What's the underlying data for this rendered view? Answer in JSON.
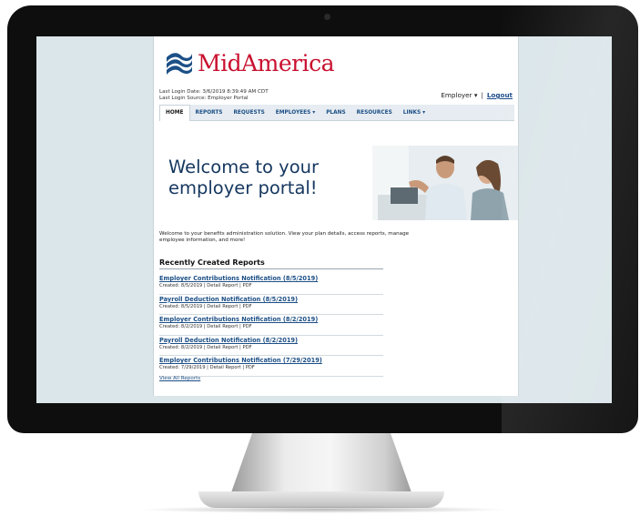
{
  "brand": {
    "name": "MidAmerica",
    "color": "#c8102e",
    "mark_color": "#1c4f86"
  },
  "login": {
    "date": "Last Login Date: 3/6/2019 8:39:49 AM CDT",
    "source": "Last Login Source: Employer Portal"
  },
  "user_menu": {
    "role": "Employer",
    "separator": "|",
    "logout": "Logout"
  },
  "nav": {
    "items": [
      {
        "label": "HOME",
        "active": true
      },
      {
        "label": "REPORTS"
      },
      {
        "label": "REQUESTS"
      },
      {
        "label": "EMPLOYEES ▾"
      },
      {
        "label": "PLANS"
      },
      {
        "label": "RESOURCES"
      },
      {
        "label": "LINKS ▾"
      }
    ]
  },
  "hero": {
    "headline_1": "Welcome to your",
    "headline_2": "employer portal!"
  },
  "intro": "Welcome to your benefits administration solution. View your plan details, access reports, manage employee information, and more!",
  "reports": {
    "title": "Recently Created Reports",
    "items": [
      {
        "title": "Employer Contributions Notification (8/5/2019)",
        "meta": "Created: 8/5/2019 | Detail Report | PDF"
      },
      {
        "title": "Payroll Deduction Notification (8/5/2019)",
        "meta": "Created: 8/5/2019 | Detail Report | PDF"
      },
      {
        "title": "Employer Contributions Notification (8/2/2019)",
        "meta": "Created: 8/2/2019 | Detail Report | PDF"
      },
      {
        "title": "Payroll Deduction Notification (8/2/2019)",
        "meta": "Created: 8/2/2019 | Detail Report | PDF"
      },
      {
        "title": "Employer Contributions Notification (7/29/2019)",
        "meta": "Created: 7/29/2019 | Detail Report | PDF"
      }
    ],
    "view_all": "View All Reports"
  },
  "colors": {
    "nav_link": "#1c4f86",
    "headline": "#15375f",
    "screen_bg": "#dbe6ea"
  }
}
